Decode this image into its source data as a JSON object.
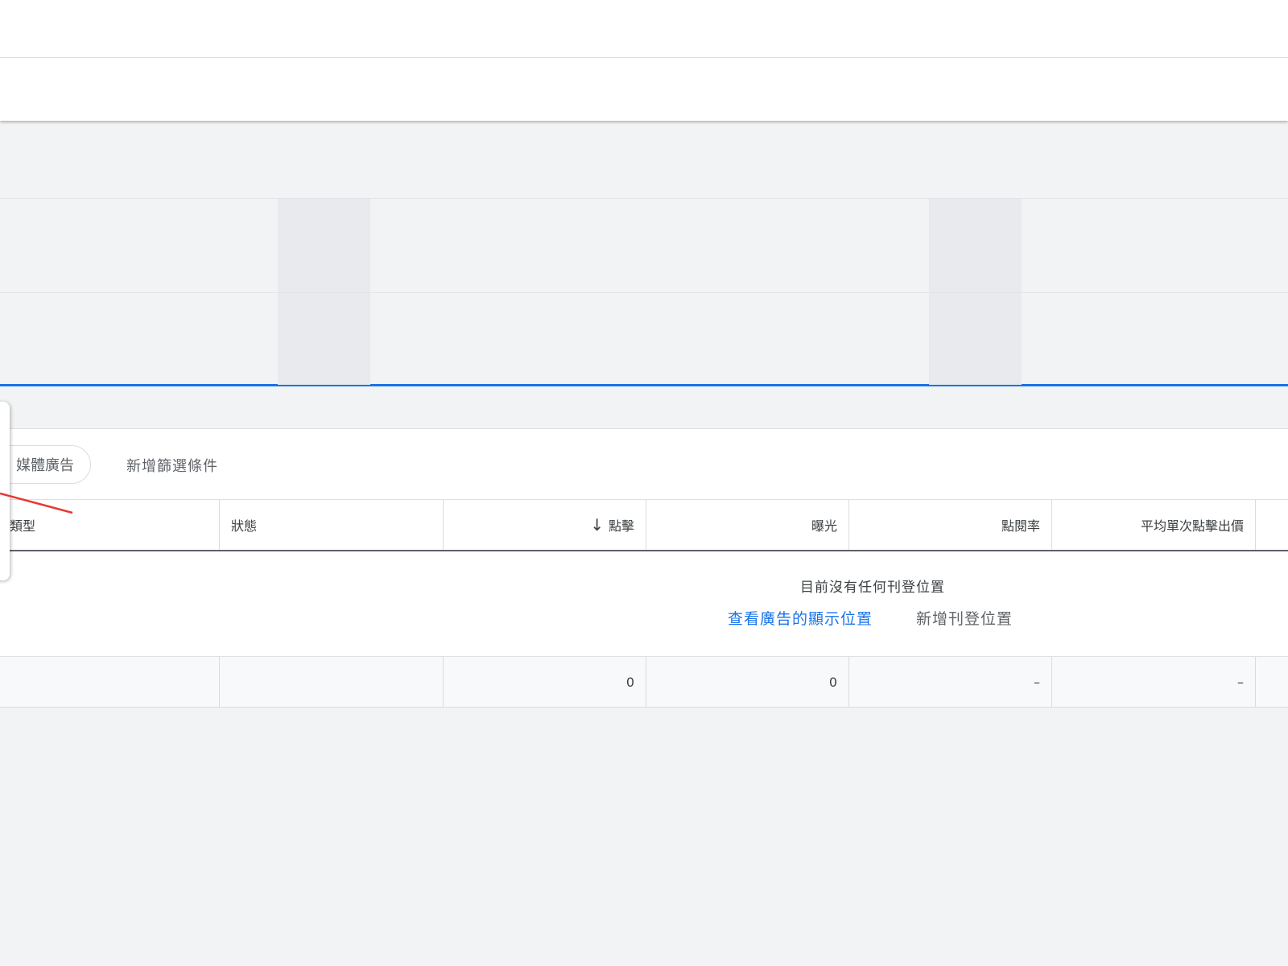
{
  "filters": {
    "chip_label": "媒體廣告",
    "add_filter_label": "新增篩選條件"
  },
  "table": {
    "columns": [
      "類型",
      "狀態",
      "點擊",
      "曝光",
      "點閱率",
      "平均單次點擊出價"
    ],
    "sort_icon": "arrow-down-icon",
    "empty_message": "目前沒有任何刊登位置",
    "view_link": "查看廣告的顯示位置",
    "add_link": "新增刊登位置",
    "totals": [
      "",
      "",
      "0",
      "0",
      "–",
      "–"
    ]
  },
  "colors": {
    "accent": "#1a73e8",
    "annotation": "#e53935",
    "page_bg": "#f1f3f4"
  }
}
